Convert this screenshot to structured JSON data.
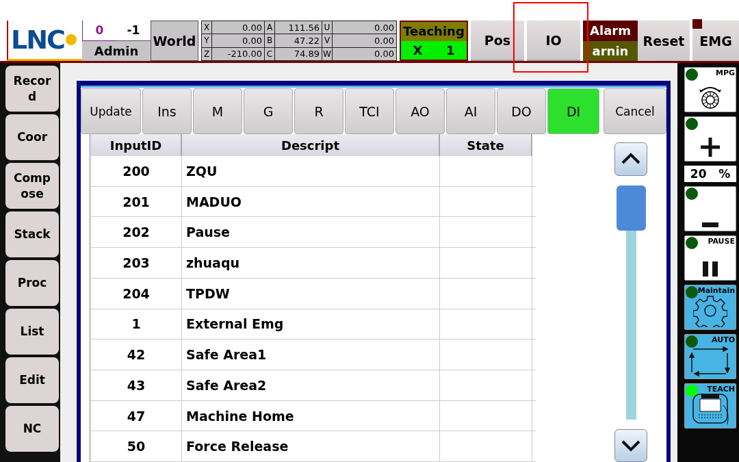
{
  "logo": {
    "text": "LNC"
  },
  "user": {
    "group": "0",
    "level": "-1",
    "name": "Admin"
  },
  "coord_system": "World",
  "coordinates": [
    {
      "cells": [
        {
          "axis": "X",
          "value": "0.00"
        },
        {
          "axis": "A",
          "value": "111.56"
        },
        {
          "axis": "U",
          "value": "0.00"
        }
      ]
    },
    {
      "cells": [
        {
          "axis": "Y",
          "value": "0.00"
        },
        {
          "axis": "B",
          "value": "47.22"
        },
        {
          "axis": "V",
          "value": "0.00"
        }
      ]
    },
    {
      "cells": [
        {
          "axis": "Z",
          "value": "-210.00"
        },
        {
          "axis": "C",
          "value": "74.89"
        },
        {
          "axis": "W",
          "value": "0.00"
        }
      ]
    }
  ],
  "mode": {
    "label": "Teaching",
    "axis": "X",
    "step": "1"
  },
  "top_buttons": [
    {
      "label": "Pos",
      "highlighted": false
    },
    {
      "label": "IO",
      "highlighted": true
    }
  ],
  "alarm": {
    "alarm": "Alarm",
    "warning": "arnin"
  },
  "reset": "Reset",
  "emg": "EMG",
  "sidebar": {
    "items": [
      {
        "label": "Record"
      },
      {
        "label": "Coor"
      },
      {
        "label": "Compose"
      },
      {
        "label": "Stack"
      },
      {
        "label": "Proc"
      },
      {
        "label": "List"
      },
      {
        "label": "Edit"
      },
      {
        "label": "NC"
      }
    ]
  },
  "dialog": {
    "tabs": [
      {
        "label": "Update",
        "selected": false
      },
      {
        "label": "Ins",
        "selected": false
      },
      {
        "label": "M",
        "selected": false
      },
      {
        "label": "G",
        "selected": false
      },
      {
        "label": "R",
        "selected": false
      },
      {
        "label": "TCI",
        "selected": false
      },
      {
        "label": "AO",
        "selected": false
      },
      {
        "label": "AI",
        "selected": false
      },
      {
        "label": "DO",
        "selected": false
      },
      {
        "label": "DI",
        "selected": true
      }
    ],
    "cancel": "Cancel",
    "table": {
      "columns": [
        "InputID",
        "Descript",
        "State"
      ],
      "rows": [
        {
          "id": "200",
          "description": "ZQU"
        },
        {
          "id": "201",
          "description": "MADUO"
        },
        {
          "id": "202",
          "description": "Pause"
        },
        {
          "id": "203",
          "description": "zhuaqu"
        },
        {
          "id": "204",
          "description": "TPDW"
        },
        {
          "id": "1",
          "description": "External Emg"
        },
        {
          "id": "42",
          "description": "Safe Area1"
        },
        {
          "id": "43",
          "description": "Safe Area2"
        },
        {
          "id": "47",
          "description": "Machine Home"
        },
        {
          "id": "50",
          "description": "Force Release"
        }
      ]
    }
  },
  "side_panel": [
    {
      "kind": "mpg",
      "label": "MPG",
      "lit": false
    },
    {
      "kind": "plus",
      "lit": false
    },
    {
      "kind": "readout",
      "value": "20",
      "unit": "%"
    },
    {
      "kind": "minus",
      "lit": false
    },
    {
      "kind": "pause",
      "label": "PAUSE",
      "lit": false
    },
    {
      "kind": "maintain",
      "label": "Maintain",
      "lit": false
    },
    {
      "kind": "auto",
      "label": "AUTO",
      "lit": false
    },
    {
      "kind": "teach",
      "label": "TEACH",
      "lit": true
    }
  ]
}
